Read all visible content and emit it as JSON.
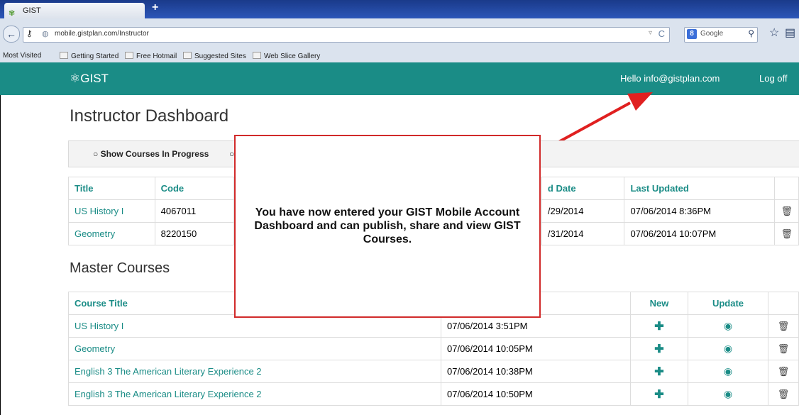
{
  "browser": {
    "tab_title": "GIST",
    "new_tab": "+",
    "url": "mobile.gistplan.com/Instructor",
    "search_engine": "Google",
    "bookmarks": [
      "Most Visited",
      "Getting Started",
      "Free Hotmail",
      "Suggested Sites",
      "Web Slice Gallery"
    ]
  },
  "app": {
    "logo": "GIST",
    "hello": "Hello info@gistplan.com",
    "logoff": "Log off",
    "accent": "#1a8c86"
  },
  "page": {
    "title": "Instructor Dashboard",
    "filter_option": "Show Courses In Progress"
  },
  "courses": {
    "headers": [
      "Title",
      "Code",
      "d Date",
      "Last Updated"
    ],
    "rows": [
      {
        "title": "US History I",
        "code": "4067011",
        "end": "/29/2014",
        "updated": "07/06/2014 8:36PM"
      },
      {
        "title": "Geometry",
        "code": "8220150",
        "end": "/31/2014",
        "updated": "07/06/2014 10:07PM"
      }
    ]
  },
  "master": {
    "title": "Master Courses",
    "headers": [
      "Course Title",
      "New",
      "Update"
    ],
    "rows": [
      {
        "title": "US History I",
        "date": "07/06/2014 3:51PM"
      },
      {
        "title": "Geometry",
        "date": "07/06/2014 10:05PM"
      },
      {
        "title": "English 3 The American Literary Experience 2",
        "date": "07/06/2014 10:38PM"
      },
      {
        "title": "English 3 The American Literary Experience 2",
        "date": "07/06/2014 10:50PM"
      }
    ]
  },
  "callout": {
    "text": "You have now entered your GIST Mobile Account Dashboard and can publish, share and view GIST Courses."
  }
}
